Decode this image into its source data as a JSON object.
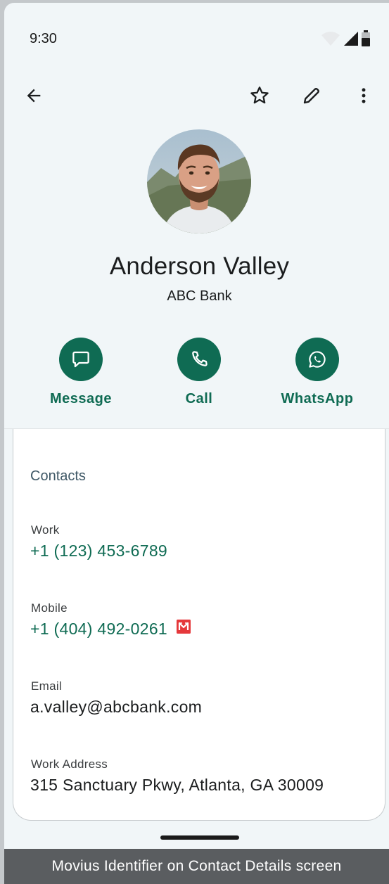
{
  "status_bar": {
    "time": "9:30",
    "icons": [
      "wifi-icon",
      "signal-icon",
      "battery-icon"
    ]
  },
  "app_bar": {
    "icons": [
      "back-arrow-icon",
      "star-icon",
      "edit-pencil-icon",
      "more-vert-icon"
    ]
  },
  "contact": {
    "name": "Anderson Valley",
    "organization": "ABC Bank"
  },
  "actions": [
    {
      "label": "Message",
      "icon": "message-icon"
    },
    {
      "label": "Call",
      "icon": "phone-icon"
    },
    {
      "label": "WhatsApp",
      "icon": "whatsapp-icon"
    }
  ],
  "contacts_section": {
    "title": "Contacts",
    "fields": [
      {
        "label": "Work",
        "value": "+1 (123) 453-6789"
      },
      {
        "label": "Mobile",
        "value": "+1 (404) 492-0261",
        "badge_icon": "movius-icon"
      },
      {
        "label": "Email",
        "value": "a.valley@abcbank.com"
      },
      {
        "label": "Work Address",
        "value": "315 Sanctuary Pkwy, Atlanta, GA 30009"
      }
    ]
  },
  "caption": "Movius Identifier on Contact Details screen",
  "colors": {
    "accent": "#0f6b53",
    "background": "#f1f6f8",
    "card": "#ffffff",
    "caption_bg": "#5a5d60",
    "movius_badge": "#e5383b"
  }
}
